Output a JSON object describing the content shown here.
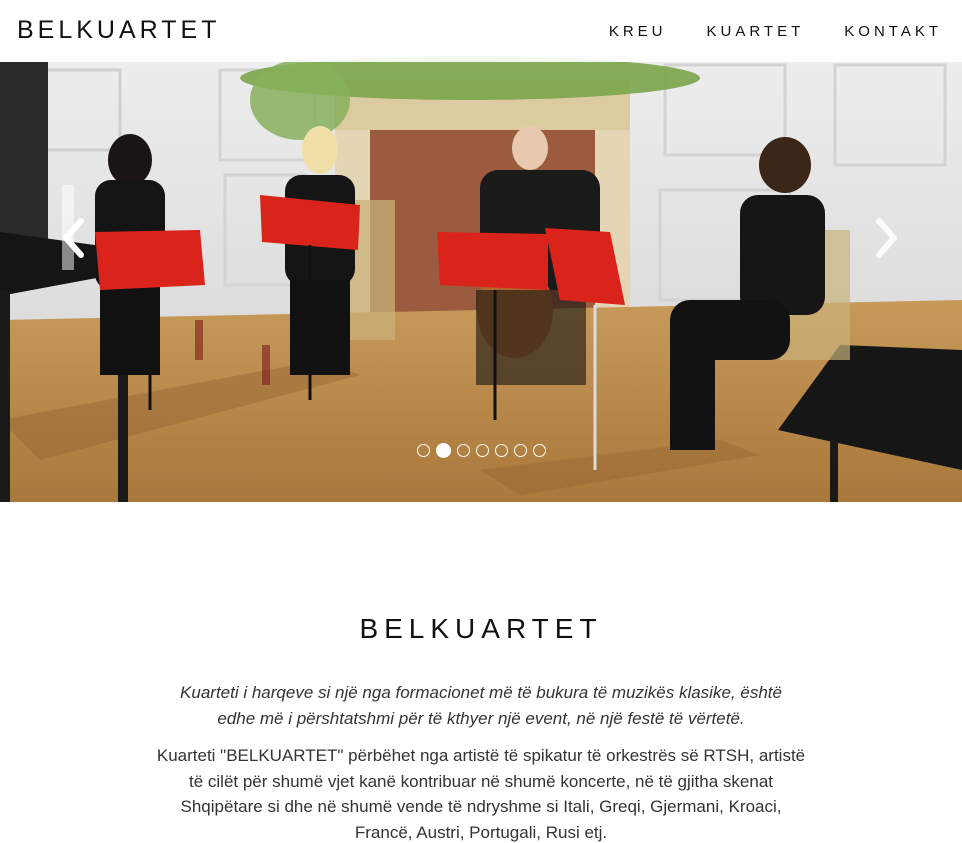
{
  "navbar": {
    "brand": "BELKUARTET",
    "links": [
      "KREU",
      "KUARTET",
      "KONTAKT"
    ]
  },
  "carousel": {
    "slide_count": 7,
    "active_index": 1,
    "prev_icon": "chevron-left-icon",
    "next_icon": "chevron-right-icon"
  },
  "about": {
    "title": "BELKUARTET",
    "lead": "Kuarteti i harqeve si një nga formacionet më të bukura të muzikës klasike, është edhe më i përshtatshmi për të kthyer një event, në një festë të vërtetë.",
    "body": "Kuarteti \"BELKUARTET\" përbëhet nga artistë të spikatur të orkestrës së RTSH, artistë të cilët për shumë vjet kanë kontribuar në shumë koncerte, në të gjitha skenat Shqipëtare si dhe në shumë vende të ndryshme si Itali, Greqi, Gjermani, Kroaci, Francë, Austri, Portugali, Rusi etj."
  },
  "colors": {
    "navbar_bg": "#ffffff",
    "text": "#111111",
    "floor": "#b78a4c",
    "music_stand": "#d9231b"
  }
}
